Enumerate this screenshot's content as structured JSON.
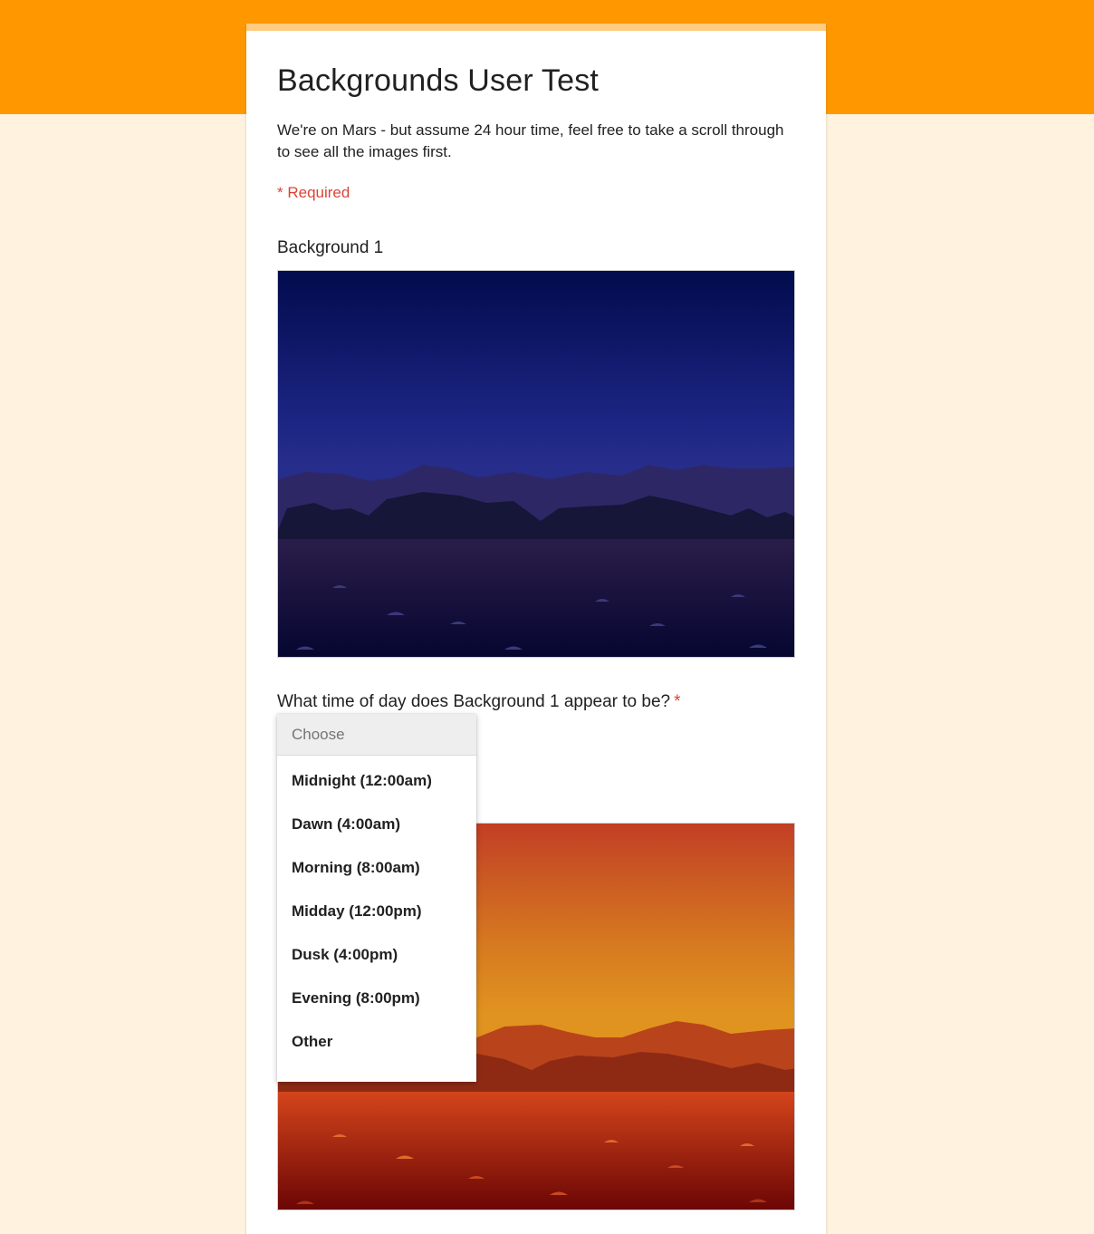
{
  "form": {
    "title": "Backgrounds User Test",
    "description": "We're on Mars - but assume 24 hour time, feel free to take a scroll through to see all the images first.",
    "required_note": "* Required",
    "section_label": "Background 1",
    "question": "What time of day does Background 1 appear to be?",
    "required_star": "*"
  },
  "dropdown": {
    "placeholder": "Choose",
    "options": [
      "Midnight (12:00am)",
      "Dawn (4:00am)",
      "Morning (8:00am)",
      "Midday (12:00pm)",
      "Dusk (4:00pm)",
      "Evening (8:00pm)",
      "Other"
    ]
  },
  "colors": {
    "header_band": "#ff9800",
    "page_background": "#fff2df",
    "card_accent": "#ffcc80",
    "required": "#db4437"
  }
}
